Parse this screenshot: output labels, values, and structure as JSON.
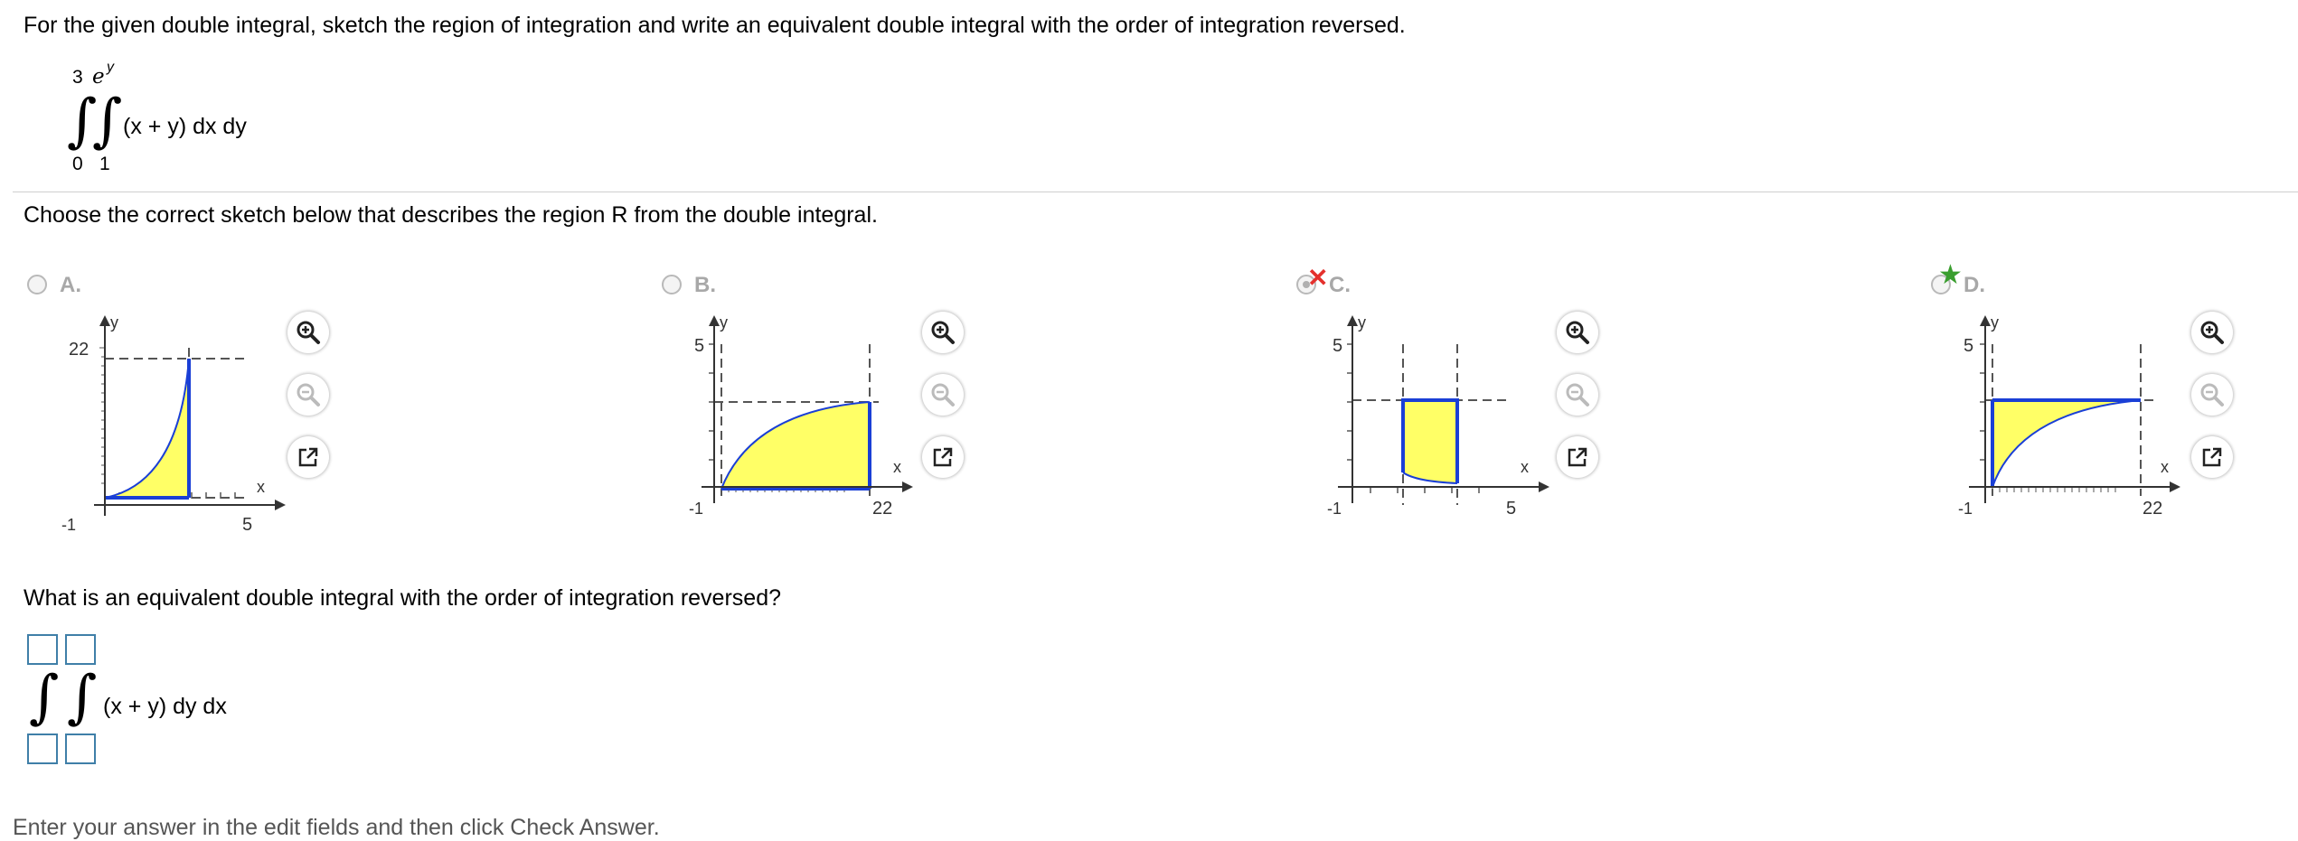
{
  "question": {
    "prompt": "For the given double integral, sketch the region of integration and write an equivalent double integral with the order of integration reversed.",
    "integral": {
      "outer_upper": "3",
      "outer_lower": "0",
      "inner_upper_base": "e",
      "inner_upper_exp": "y",
      "inner_lower": "1",
      "integrand": "(x + y) dx dy"
    }
  },
  "part1": {
    "prompt": "Choose the correct sketch below that describes the region R from the double integral.",
    "options": [
      {
        "letter": "A.",
        "y_label": "y",
        "x_label": "x",
        "y_tick": "22",
        "x_tick": "5",
        "neg_tick": "-1",
        "status": "unselected"
      },
      {
        "letter": "B.",
        "y_label": "y",
        "x_label": "x",
        "y_tick": "5",
        "x_tick": "22",
        "neg_tick": "-1",
        "status": "unselected"
      },
      {
        "letter": "C.",
        "y_label": "y",
        "x_label": "x",
        "y_tick": "5",
        "x_tick": "5",
        "neg_tick": "-1",
        "status": "incorrect"
      },
      {
        "letter": "D.",
        "y_label": "y",
        "x_label": "x",
        "y_tick": "5",
        "x_tick": "22",
        "neg_tick": "-1",
        "status": "correct"
      }
    ],
    "icons": [
      "zoom-in-icon",
      "zoom-out-icon",
      "popout-icon"
    ],
    "colors": {
      "region_fill": "#ffff66",
      "boundary": "#1a3fd6",
      "incorrect_mark": "#e4302c",
      "correct_mark": "#3a9e2f"
    }
  },
  "part2": {
    "prompt": "What is an equivalent double integral with the order of integration reversed?",
    "integrand": "(x + y) dy dx",
    "fields": {
      "outer_upper": "",
      "inner_upper": "",
      "outer_lower": "",
      "inner_lower": ""
    }
  },
  "footer": "Enter your answer in the edit fields and then click Check Answer."
}
